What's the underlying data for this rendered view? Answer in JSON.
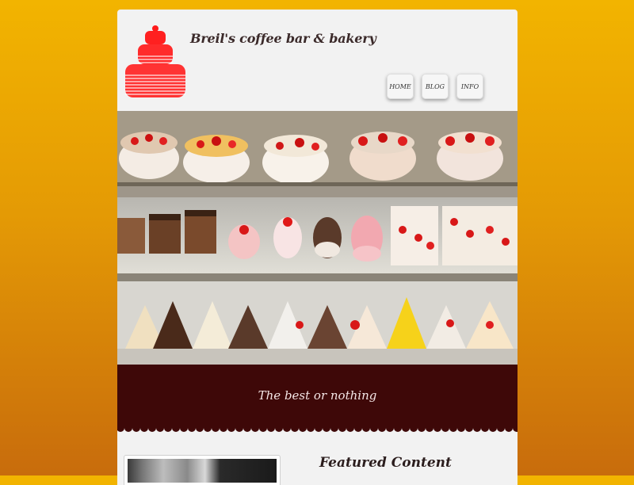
{
  "site": {
    "title": "Breil's coffee bar & bakery",
    "tagline": "The best or nothing"
  },
  "nav": {
    "items": [
      {
        "label": "HOME"
      },
      {
        "label": "BLOG"
      },
      {
        "label": "INFO"
      }
    ]
  },
  "featured": {
    "title": "Featured Content"
  },
  "colors": {
    "banner": "#3e0808",
    "logo": "#ff1a1a",
    "background_top": "#f2b400",
    "background_bottom": "#c86c0c"
  },
  "icons": {
    "logo": "layered-cake-icon"
  }
}
